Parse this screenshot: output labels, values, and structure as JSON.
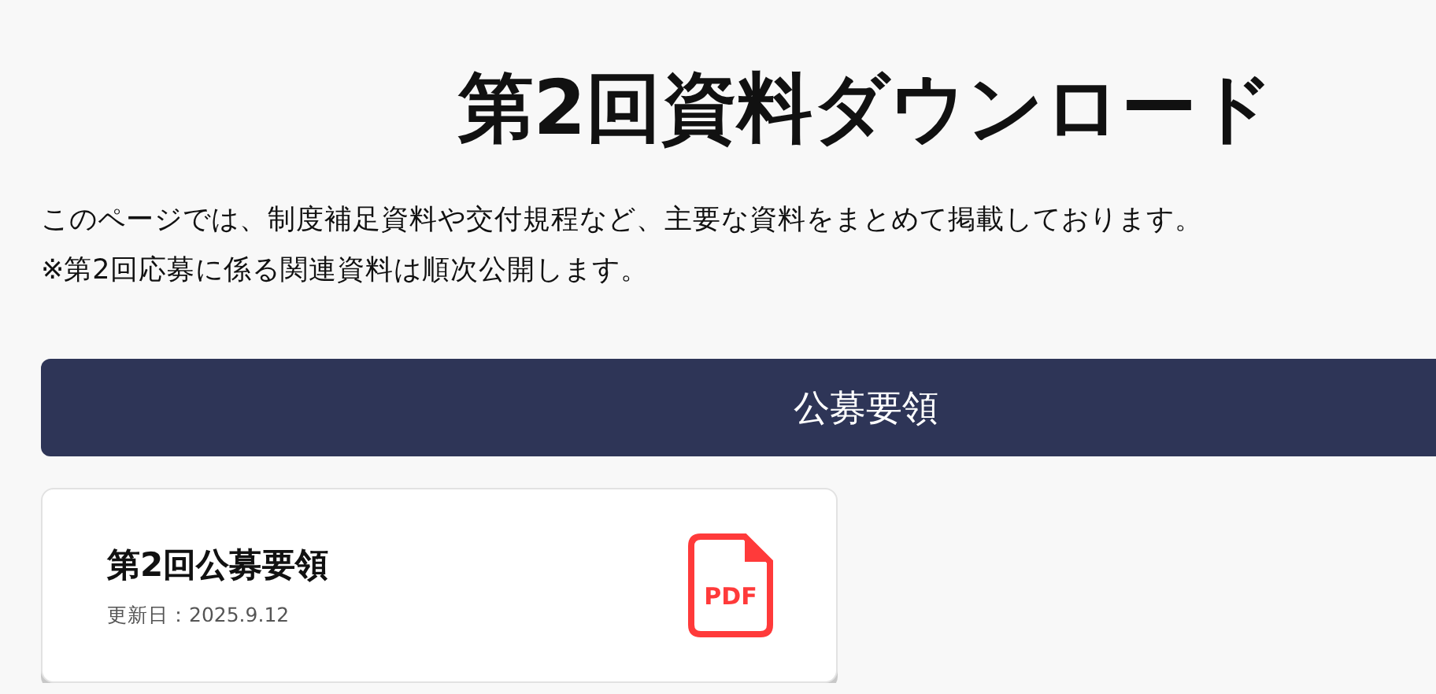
{
  "page_title": "第2回資料ダウンロード",
  "intro": [
    "このページでは、制度補足資料や交付規程など、主要な資料をまとめて掲載しております。",
    "※第2回応募に係る関連資料は順次公開します。"
  ],
  "sections": [
    {
      "heading": "公募要領",
      "documents": [
        {
          "title": "第2回公募要領",
          "updated": "更新日：2025.9.12",
          "file_type": "PDF"
        }
      ]
    }
  ]
}
